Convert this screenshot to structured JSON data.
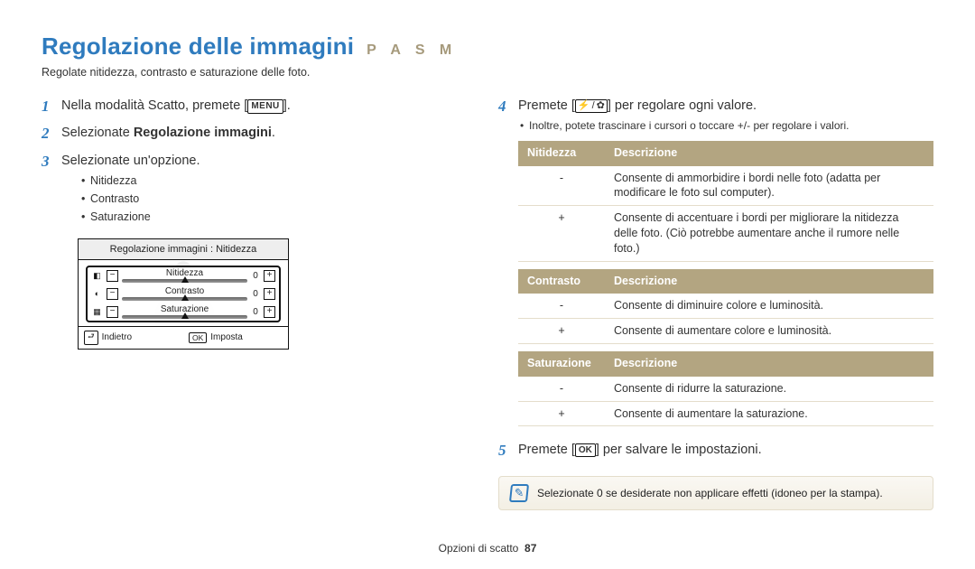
{
  "page": {
    "title": "Regolazione delle immagini",
    "mode_letters": "P A S M",
    "subtitle": "Regolate nitidezza, contrasto e saturazione delle foto.",
    "footer_section": "Opzioni di scatto",
    "footer_page": "87"
  },
  "left": {
    "step1_pre": "Nella modalità Scatto, premete [",
    "step1_menu": "MENU",
    "step1_post": "].",
    "step2_pre": "Selezionate ",
    "step2_bold": "Regolazione immagini",
    "step2_post": ".",
    "step3": "Selezionate un'opzione.",
    "options": [
      "Nitidezza",
      "Contrasto",
      "Saturazione"
    ]
  },
  "lcd": {
    "header": "Regolazione immagini : Nitidezza",
    "rows": [
      {
        "label": "Nitidezza",
        "value": "0"
      },
      {
        "label": "Contrasto",
        "value": "0"
      },
      {
        "label": "Saturazione",
        "value": "0"
      }
    ],
    "back_key": "⮐",
    "back_label": "Indietro",
    "ok_key": "OK",
    "ok_label": "Imposta"
  },
  "right": {
    "step4_pre": "Premete [",
    "step4_icon1": "⚡",
    "step4_sep": "/",
    "step4_icon2": "✿",
    "step4_post": "] per regolare ogni valore.",
    "step4_note": "Inoltre, potete trascinare i cursori o toccare +/- per regolare i valori.",
    "step5_pre": "Premete [",
    "step5_key": "OK",
    "step5_post": "] per salvare le impostazioni.",
    "tables": {
      "nitidezza": {
        "head1": "Nitidezza",
        "head2": "Descrizione",
        "rows": [
          {
            "sign": "-",
            "text": "Consente di ammorbidire i bordi nelle foto (adatta per modificare le foto sul computer)."
          },
          {
            "sign": "+",
            "text": "Consente di accentuare i bordi per migliorare la nitidezza delle foto. (Ciò potrebbe aumentare anche il rumore nelle foto.)"
          }
        ]
      },
      "contrasto": {
        "head1": "Contrasto",
        "head2": "Descrizione",
        "rows": [
          {
            "sign": "-",
            "text": "Consente di diminuire colore e luminosità."
          },
          {
            "sign": "+",
            "text": "Consente di aumentare colore e luminosità."
          }
        ]
      },
      "saturazione": {
        "head1": "Saturazione",
        "head2": "Descrizione",
        "rows": [
          {
            "sign": "-",
            "text": "Consente di ridurre la saturazione."
          },
          {
            "sign": "+",
            "text": "Consente di aumentare la saturazione."
          }
        ]
      }
    },
    "hint": "Selezionate 0 se desiderate non applicare effetti (idoneo per la stampa)."
  }
}
